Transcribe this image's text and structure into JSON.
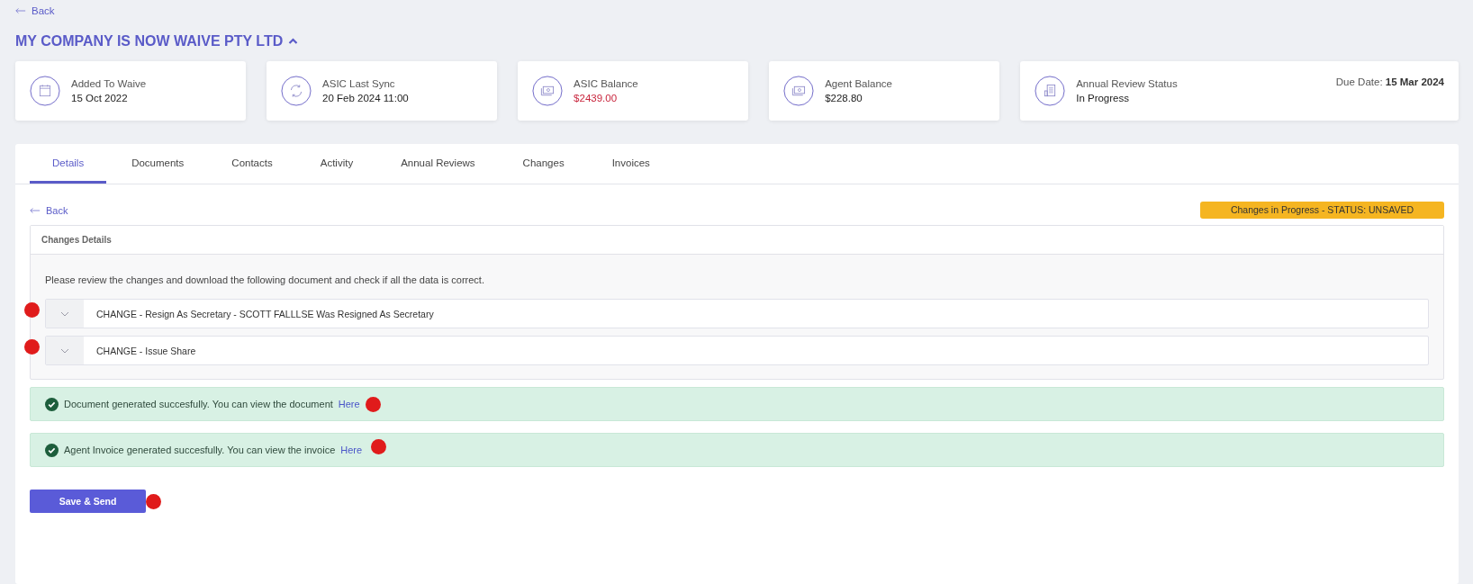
{
  "back_link": "Back",
  "company": {
    "name": "MY COMPANY IS NOW WAIVE PTY LTD",
    "expanded": true
  },
  "summary_cards": [
    {
      "kind": "calendar",
      "label": "Added To Waive",
      "value": "15 Oct 2022",
      "negative": false
    },
    {
      "kind": "sync",
      "label": "ASIC Last Sync",
      "value": "20 Feb 2024 11:00",
      "negative": false
    },
    {
      "kind": "money",
      "label": "ASIC Balance",
      "value": "$2439.00",
      "negative": true
    },
    {
      "kind": "money",
      "label": "Agent Balance",
      "value": "$228.80",
      "negative": false
    },
    {
      "kind": "report",
      "label": "Annual Review Status",
      "value": "In Progress",
      "negative": false,
      "due_label": "Due Date:",
      "due_value": "15 Mar 2024"
    }
  ],
  "tabs": [
    {
      "label": "Details",
      "selected": true
    },
    {
      "label": "Documents",
      "selected": false
    },
    {
      "label": "Contacts",
      "selected": false
    },
    {
      "label": "Activity",
      "selected": false
    },
    {
      "label": "Annual Reviews",
      "selected": false
    },
    {
      "label": "Changes",
      "selected": false
    },
    {
      "label": "Invoices",
      "selected": false
    }
  ],
  "details": {
    "back_link": "Back",
    "status_badge": "Changes in Progress - STATUS: UNSAVED",
    "section_title": "Changes Details",
    "description": "Please review the changes and download the following document and check if all the data is correct.",
    "changes": [
      {
        "title": "CHANGE - Resign As Secretary - SCOTT FALLLSE Was Resigned As Secretary",
        "expanded": false,
        "flagged": true
      },
      {
        "title": "CHANGE - Issue Share",
        "expanded": false,
        "flagged": true
      }
    ],
    "alerts": [
      {
        "text": "Document generated succesfully. You can view the document",
        "link": "Here",
        "flagged": true
      },
      {
        "text": "Agent Invoice generated succesfully. You can view the invoice",
        "link": "Here",
        "flagged": true
      }
    ],
    "primary_button": {
      "label": "Save & Send",
      "flagged": true
    }
  }
}
